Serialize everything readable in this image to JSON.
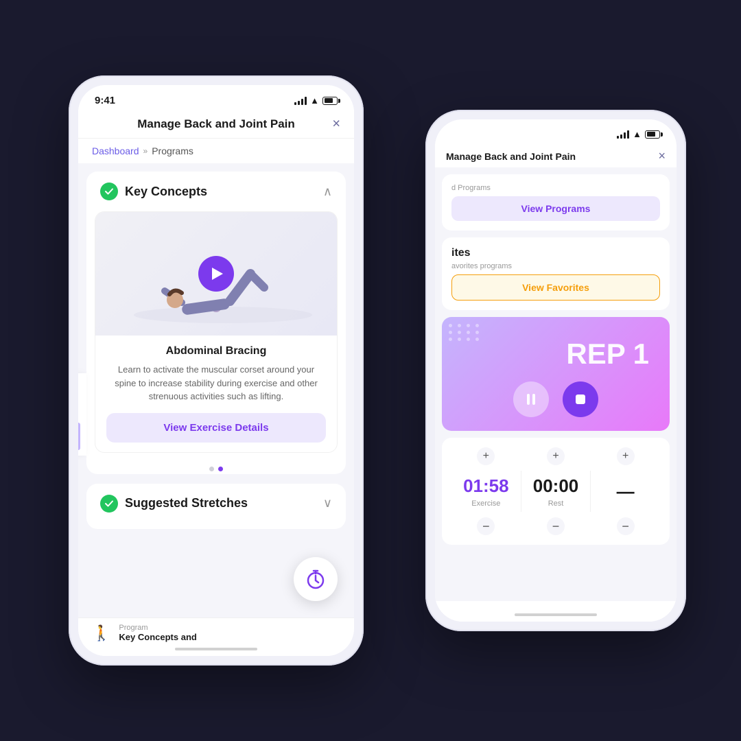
{
  "background": "#1a1a2e",
  "front_phone": {
    "status_bar": {
      "time": "9:41"
    },
    "nav": {
      "title": "Manage Back and Joint Pain",
      "close_label": "×"
    },
    "breadcrumb": {
      "link": "Dashboard",
      "separator": "»",
      "current": "Programs"
    },
    "key_concepts_section": {
      "title": "Key Concepts",
      "exercise": {
        "name": "Abdominal Bracing",
        "description": "Learn to activate the muscular corset around your spine to increase stability during exercise and other strenuous activities such as lifting.",
        "view_btn": "View Exercise Details"
      },
      "dots": [
        {
          "active": false
        },
        {
          "active": true
        }
      ]
    },
    "suggested_stretches": {
      "title": "Suggested Stretches"
    },
    "bottom_bar": {
      "icon": "🚶",
      "label": "Program",
      "sublabel": "Key Concepts and"
    }
  },
  "back_phone": {
    "nav": {
      "title": "Manage Back and Joint Pain",
      "close_label": "×"
    },
    "programs_section": {
      "label": "d Programs",
      "btn": "View Programs"
    },
    "favorites_section": {
      "title": "ites",
      "label": "avorites programs",
      "btn": "View Favorites"
    },
    "rep_card": {
      "rep_text": "REP 1"
    },
    "timer": {
      "exercise_value": "01:58",
      "exercise_label": "Exercise",
      "rest_value": "00:00",
      "rest_label": "Rest",
      "plus_sign": "+",
      "minus_sign": "−"
    }
  }
}
